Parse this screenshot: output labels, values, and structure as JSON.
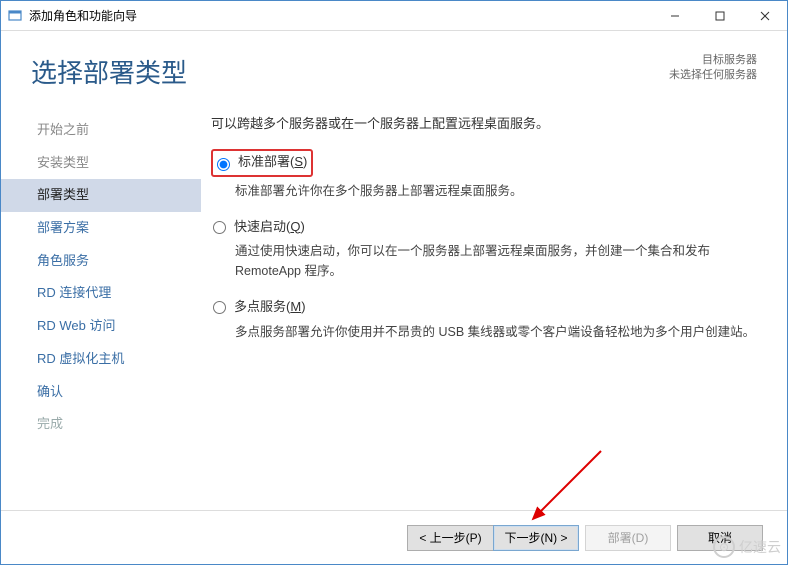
{
  "window": {
    "title": "添加角色和功能向导"
  },
  "header": {
    "title": "选择部署类型",
    "srv_label": "目标服务器",
    "srv_value": "未选择任何服务器"
  },
  "sidebar": {
    "items": [
      {
        "label": "开始之前",
        "state": "done"
      },
      {
        "label": "安装类型",
        "state": "done"
      },
      {
        "label": "部署类型",
        "state": "active"
      },
      {
        "label": "部署方案",
        "state": "pending"
      },
      {
        "label": "角色服务",
        "state": "pending"
      },
      {
        "label": "RD 连接代理",
        "state": "pending"
      },
      {
        "label": "RD Web 访问",
        "state": "pending"
      },
      {
        "label": "RD 虚拟化主机",
        "state": "pending"
      },
      {
        "label": "确认",
        "state": "pending"
      },
      {
        "label": "完成",
        "state": "disabled"
      }
    ]
  },
  "content": {
    "intro": "可以跨越多个服务器或在一个服务器上配置远程桌面服务。",
    "options": [
      {
        "label_pre": "标准部署(",
        "label_key": "S",
        "label_post": ")",
        "desc": "标准部署允许你在多个服务器上部署远程桌面服务。",
        "checked": true,
        "highlighted": true
      },
      {
        "label_pre": "快速启动(",
        "label_key": "Q",
        "label_post": ")",
        "desc": "通过使用快速启动，你可以在一个服务器上部署远程桌面服务，并创建一个集合和发布 RemoteApp 程序。",
        "checked": false,
        "highlighted": false
      },
      {
        "label_pre": "多点服务(",
        "label_key": "M",
        "label_post": ")",
        "desc": "多点服务部署允许你使用并不昂贵的 USB 集线器或零个客户端设备轻松地为多个用户创建站。",
        "checked": false,
        "highlighted": false
      }
    ]
  },
  "footer": {
    "prev": "< 上一步(P)",
    "next": "下一步(N) >",
    "deploy": "部署(D)",
    "cancel": "取消"
  },
  "watermark": {
    "text": "亿速云",
    "icon": "⊙"
  }
}
